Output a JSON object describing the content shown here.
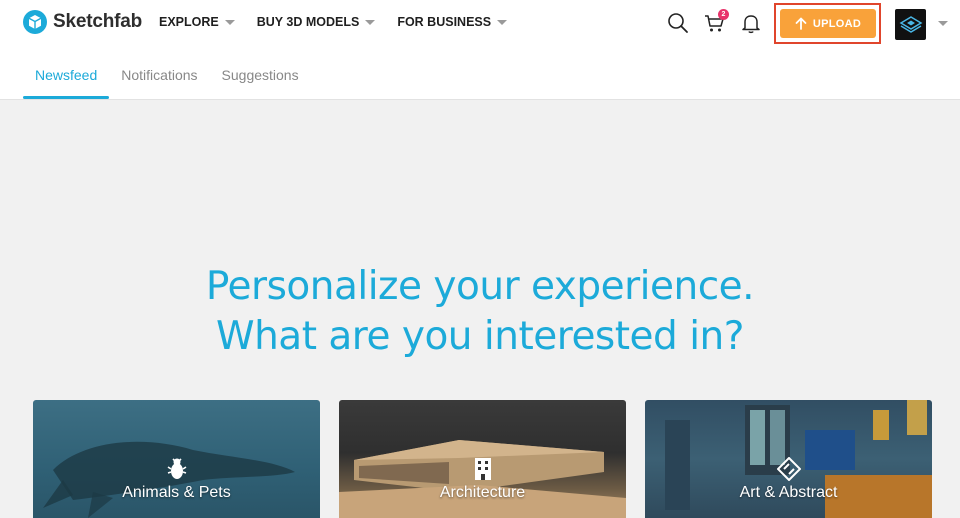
{
  "brand": {
    "name": "Sketchfab"
  },
  "nav": {
    "items": [
      {
        "label": "EXPLORE"
      },
      {
        "label": "BUY 3D MODELS"
      },
      {
        "label": "FOR BUSINESS"
      }
    ]
  },
  "header": {
    "cart_badge": "2",
    "upload_label": "UPLOAD"
  },
  "tabs": [
    {
      "label": "Newsfeed",
      "active": true
    },
    {
      "label": "Notifications",
      "active": false
    },
    {
      "label": "Suggestions",
      "active": false
    }
  ],
  "main": {
    "headline_line1": "Personalize your experience.",
    "headline_line2": "What are you interested in?"
  },
  "categories": [
    {
      "label": "Animals & Pets",
      "icon": "bug-icon"
    },
    {
      "label": "Architecture",
      "icon": "building-icon"
    },
    {
      "label": "Art & Abstract",
      "icon": "abstract-icon"
    }
  ],
  "colors": {
    "accent": "#1caad9",
    "upload": "#f9a23a",
    "highlight": "#e0452c",
    "badge": "#e8336b"
  }
}
